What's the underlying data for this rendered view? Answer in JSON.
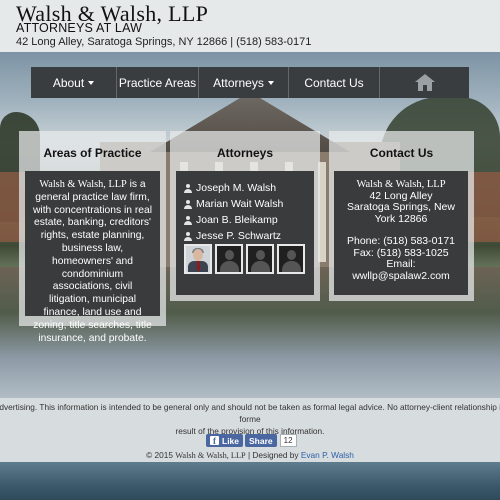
{
  "header": {
    "firm_name": "Walsh & Walsh, LLP",
    "subtitle": "ATTORNEYS AT LAW",
    "address": "42 Long Alley, Saratoga Springs, NY 12866 | (518) 583-0171"
  },
  "nav": {
    "items": [
      {
        "label": "About",
        "dropdown": true
      },
      {
        "label": "Practice Areas",
        "dropdown": false
      },
      {
        "label": "Attorneys",
        "dropdown": true
      },
      {
        "label": "Contact Us",
        "dropdown": false
      }
    ],
    "home_icon": "home-icon"
  },
  "areas": {
    "title": "Areas of Practice",
    "firm_name": "Walsh & Walsh, LLP",
    "description": " is a general practice law firm, with concentrations in real estate, banking, creditors' rights, estate planning, business law, homeowners' and condominium associations, civil litigation, municipal finance, land use and zoning, title searches, title insurance, and probate."
  },
  "attorneys": {
    "title": "Attorneys",
    "names": [
      "Joseph M. Walsh",
      "Marian Wait Walsh",
      "Joan B. Bleikamp",
      "Jesse P. Schwartz"
    ]
  },
  "contact": {
    "title": "Contact Us",
    "firm_name": "Walsh & Walsh, LLP",
    "street": "42 Long Alley",
    "city": "Saratoga Springs, New York 12866",
    "phone": "Phone: (518) 583-0171",
    "fax": "Fax: (518) 583-1025",
    "email_label": "Email:",
    "email": "wwllp@spalaw2.com"
  },
  "footer": {
    "disclaimer_line1": "advertising. This information is intended to be general only and should not be taken as formal legal advice. No attorney-client relationship is forme",
    "disclaimer_line2": "result of the provision of this information.",
    "fb_like": "Like",
    "fb_share": "Share",
    "fb_count": "12",
    "copyright_prefix": "© 2015 ",
    "copyright_firm": "Walsh & Walsh, LLP",
    "copyright_mid": " | Designed by ",
    "designer": "Evan P. Walsh"
  },
  "colors": {
    "nav_bg": "#3a3d3f",
    "panel_bg": "#3a3b3c",
    "link": "#2c5ea8",
    "facebook": "#4b67a1"
  }
}
